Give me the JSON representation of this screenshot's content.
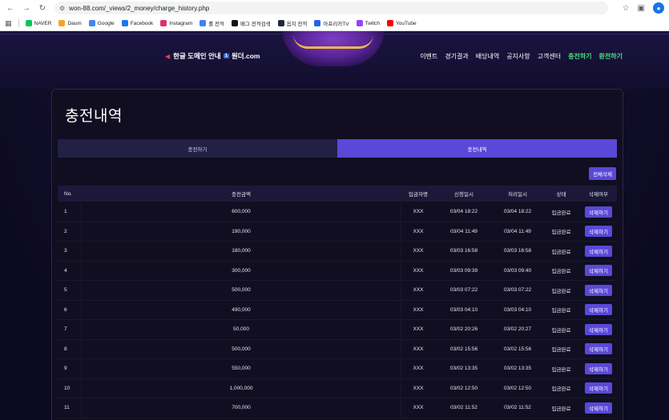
{
  "browser": {
    "url": "won-88.com/_views/2_money/charge_history.php",
    "bookmarks": [
      {
        "label": "NAVER",
        "color": "#03c75a"
      },
      {
        "label": "Daum",
        "color": "#f5a623"
      },
      {
        "label": "Google",
        "color": "#4285f4"
      },
      {
        "label": "Facebook",
        "color": "#1877f2"
      },
      {
        "label": "Instagram",
        "color": "#e1306c"
      },
      {
        "label": "롤 전적",
        "color": "#3b82f6"
      },
      {
        "label": "배그 전적검색",
        "color": "#111111"
      },
      {
        "label": "옵치 전적",
        "color": "#1f2937"
      },
      {
        "label": "아프리카TV",
        "color": "#2563eb"
      },
      {
        "label": "Twitch",
        "color": "#9146ff"
      },
      {
        "label": "YouTube",
        "color": "#ff0000"
      }
    ]
  },
  "header": {
    "notice_text": "한글 도메인 안내",
    "notice_badge": "1",
    "notice_domain": "원더.com",
    "nav": [
      {
        "label": "이벤트",
        "highlight": false
      },
      {
        "label": "경기결과",
        "highlight": false
      },
      {
        "label": "배당내역",
        "highlight": false
      },
      {
        "label": "공지사항",
        "highlight": false
      },
      {
        "label": "고객센터",
        "highlight": false
      },
      {
        "label": "충전하기",
        "highlight": true
      },
      {
        "label": "환전하기",
        "highlight": true
      }
    ]
  },
  "page": {
    "title": "충전내역",
    "tabs": [
      {
        "label": "충전하기",
        "active": false
      },
      {
        "label": "충전내역",
        "active": true
      }
    ],
    "delete_all_label": "전체삭제"
  },
  "table": {
    "headers": {
      "no": "No.",
      "amount": "충전금액",
      "depositor": "입금자명",
      "requested": "신청일시",
      "processed": "처리일시",
      "status": "상태",
      "delete": "삭제여부"
    },
    "delete_label": "삭제하기",
    "rows": [
      {
        "no": "1",
        "amount": "600,000",
        "depositor": "XXX",
        "requested": "03/04 18:22",
        "processed": "03/04 18:22",
        "status": "입금완료"
      },
      {
        "no": "2",
        "amount": "190,000",
        "depositor": "XXX",
        "requested": "03/04 11:49",
        "processed": "03/04 11:49",
        "status": "입금완료"
      },
      {
        "no": "3",
        "amount": "180,000",
        "depositor": "XXX",
        "requested": "03/03 16:58",
        "processed": "03/03 16:58",
        "status": "입금완료"
      },
      {
        "no": "4",
        "amount": "300,000",
        "depositor": "XXX",
        "requested": "03/03 09:39",
        "processed": "03/03 09:40",
        "status": "입금완료"
      },
      {
        "no": "5",
        "amount": "500,000",
        "depositor": "XXX",
        "requested": "03/03 07:22",
        "processed": "03/03 07:22",
        "status": "입금완료"
      },
      {
        "no": "6",
        "amount": "490,000",
        "depositor": "XXX",
        "requested": "03/03 04:10",
        "processed": "03/03 04:10",
        "status": "입금완료"
      },
      {
        "no": "7",
        "amount": "50,000",
        "depositor": "XXX",
        "requested": "03/02 20:26",
        "processed": "03/02 20:27",
        "status": "입금완료"
      },
      {
        "no": "8",
        "amount": "500,000",
        "depositor": "XXX",
        "requested": "03/02 15:56",
        "processed": "03/02 15:56",
        "status": "입금완료"
      },
      {
        "no": "9",
        "amount": "550,000",
        "depositor": "XXX",
        "requested": "03/02 13:35",
        "processed": "03/02 13:35",
        "status": "입금완료"
      },
      {
        "no": "10",
        "amount": "1,000,000",
        "depositor": "XXX",
        "requested": "03/02 12:50",
        "processed": "03/02 12:50",
        "status": "입금완료"
      },
      {
        "no": "11",
        "amount": "700,000",
        "depositor": "XXX",
        "requested": "03/02 11:52",
        "processed": "03/02 11:52",
        "status": "입금완료"
      }
    ]
  }
}
